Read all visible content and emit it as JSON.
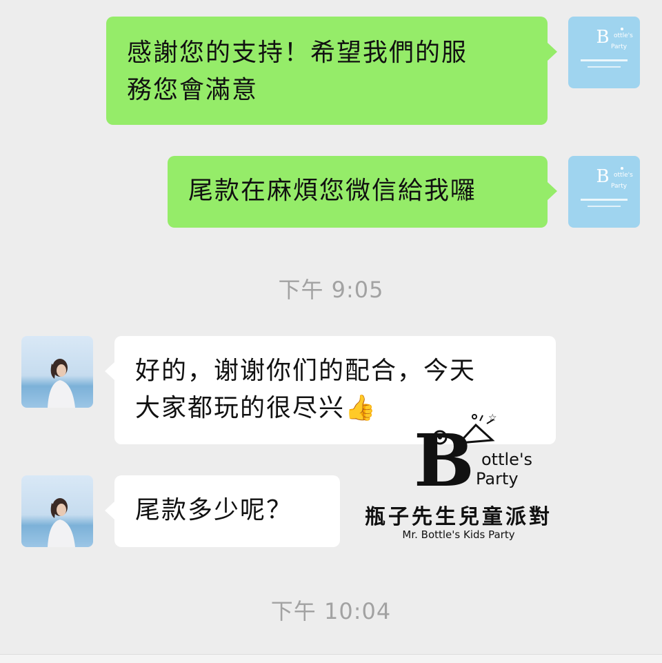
{
  "chat": {
    "messages": [
      {
        "direction": "outgoing",
        "sender": "brand",
        "lines": [
          "感謝您的支持！希望我們的服",
          "務您會滿意"
        ]
      },
      {
        "direction": "outgoing",
        "sender": "brand",
        "lines": [
          "尾款在麻煩您微信給我囉"
        ]
      },
      {
        "type": "timestamp",
        "text": "下午 9:05"
      },
      {
        "direction": "incoming",
        "sender": "customer",
        "lines": [
          "好的，谢谢你们的配合，今天",
          "大家都玩的很尽兴"
        ],
        "emoji": "👍"
      },
      {
        "direction": "incoming",
        "sender": "customer",
        "lines": [
          "尾款多少呢？"
        ]
      },
      {
        "type": "timestamp",
        "text": "下午 10:04"
      }
    ]
  },
  "avatars": {
    "brand": {
      "logo_text": "Bottle's Party",
      "caption": "瓶子先生兒童派對",
      "caption_en": "Mr. Bottle's Kids Party"
    },
    "customer": {
      "icon": "person-photo"
    }
  },
  "watermark": {
    "logo_text": "Bottle's Party",
    "title": "瓶子先生兒童派對",
    "subtitle": "Mr. Bottle's Kids Party"
  },
  "colors": {
    "background": "#ededed",
    "outgoing_bubble": "#95ec69",
    "incoming_bubble": "#ffffff",
    "timestamp_text": "#a2a2a2"
  }
}
